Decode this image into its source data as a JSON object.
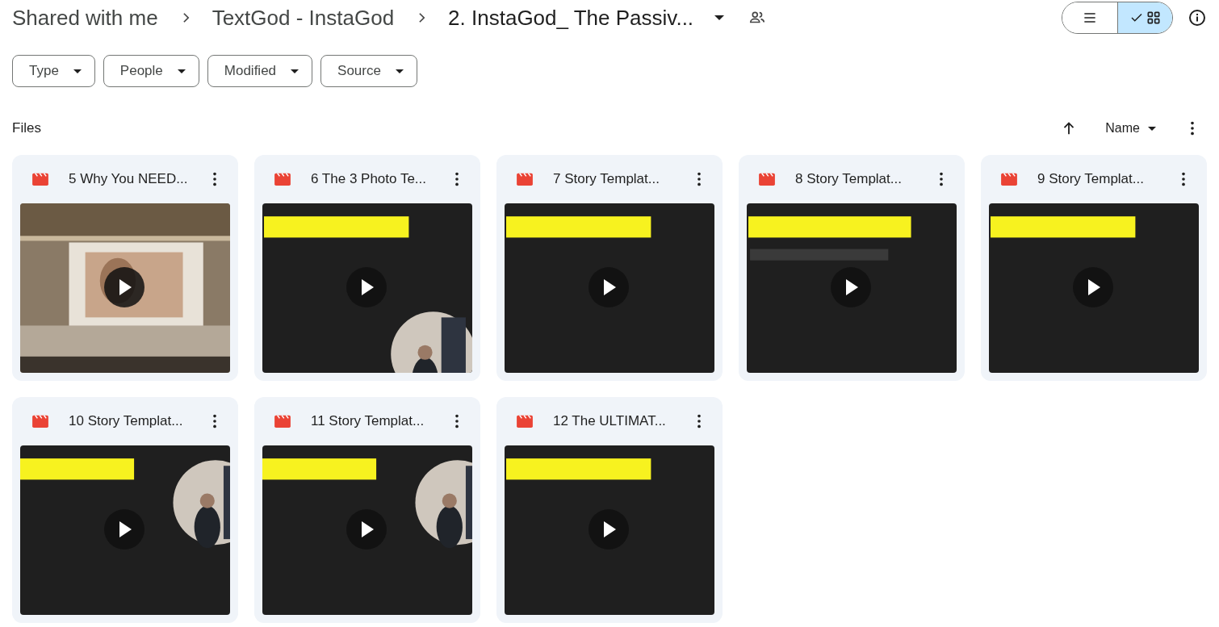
{
  "breadcrumbs": [
    {
      "label": "Shared with me"
    },
    {
      "label": "TextGod - InstaGod"
    },
    {
      "label": "2. InstaGod_ The Passiv..."
    }
  ],
  "view_toggle": [
    {
      "kind": "list",
      "selected": false
    },
    {
      "kind": "grid",
      "selected": true
    }
  ],
  "filters": [
    {
      "label": "Type"
    },
    {
      "label": "People"
    },
    {
      "label": "Modified"
    },
    {
      "label": "Source"
    }
  ],
  "section": {
    "title": "Files",
    "sort": "Name"
  },
  "files": [
    {
      "name": "5 Why You NEED..."
    },
    {
      "name": "6 The 3 Photo Te..."
    },
    {
      "name": "7 Story Templat..."
    },
    {
      "name": "8 Story Templat..."
    },
    {
      "name": "9 Story Templat..."
    },
    {
      "name": "10 Story Templat..."
    },
    {
      "name": "11 Story Templat..."
    },
    {
      "name": "12 The ULTIMAT..."
    }
  ]
}
